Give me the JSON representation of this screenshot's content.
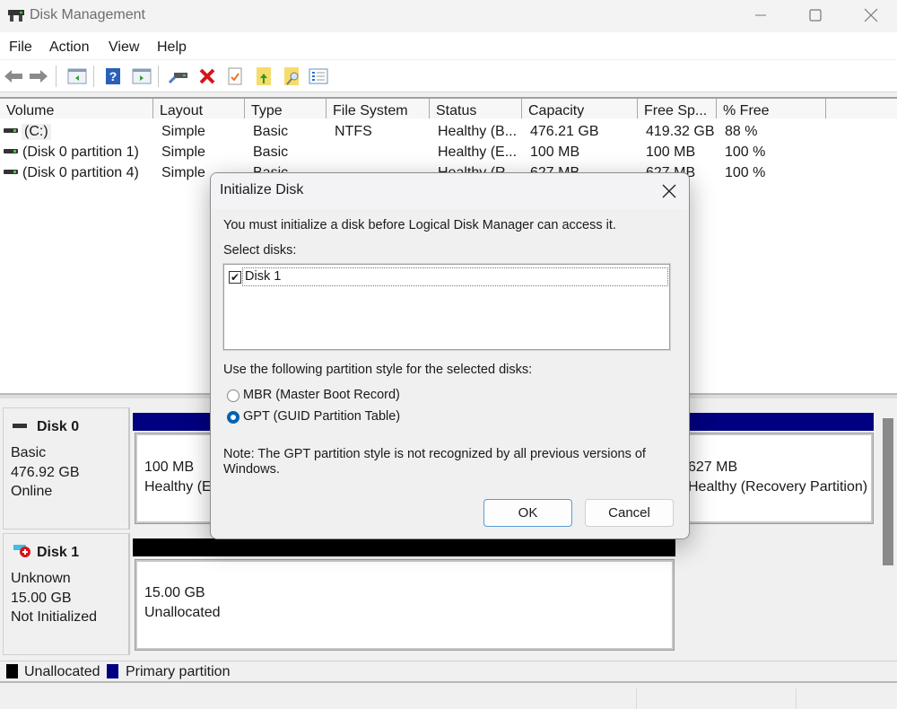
{
  "window": {
    "title": "Disk Management",
    "controls": {
      "minimize": "minimize",
      "maximize": "maximize",
      "close": "close"
    }
  },
  "menu": [
    "File",
    "Action",
    "View",
    "Help"
  ],
  "toolbar": [
    {
      "icon": "back-arrow-icon"
    },
    {
      "icon": "forward-arrow-icon"
    },
    {
      "icon": "show-hide-console-tree-icon"
    },
    {
      "icon": "help-icon"
    },
    {
      "icon": "show-hide-action-pane-icon"
    },
    {
      "icon": "connect-drive-icon"
    },
    {
      "icon": "delete-icon"
    },
    {
      "icon": "properties-check-icon"
    },
    {
      "icon": "export-folder-icon"
    },
    {
      "icon": "search-folder-icon"
    },
    {
      "icon": "checklist-icon"
    }
  ],
  "volume_list": {
    "columns": [
      "Volume",
      "Layout",
      "Type",
      "File System",
      "Status",
      "Capacity",
      "Free Sp...",
      "% Free"
    ],
    "rows": [
      {
        "volume": "(C:)",
        "layout": "Simple",
        "type": "Basic",
        "fs": "NTFS",
        "status": "Healthy (B...",
        "capacity": "476.21 GB",
        "free": "419.32 GB",
        "pct": "88 %"
      },
      {
        "volume": "(Disk 0 partition 1)",
        "layout": "Simple",
        "type": "Basic",
        "fs": "",
        "status": "Healthy (E...",
        "capacity": "100 MB",
        "free": "100 MB",
        "pct": "100 %"
      },
      {
        "volume": "(Disk 0 partition 4)",
        "layout": "Simple",
        "type": "Basic",
        "fs": "",
        "status": "Healthy (R...",
        "capacity": "627 MB",
        "free": "627 MB",
        "pct": "100 %"
      }
    ]
  },
  "disks": [
    {
      "name": "Disk 0",
      "type": "Basic",
      "size": "476.92 GB",
      "state": "Online",
      "partitions": [
        {
          "size": "100 MB",
          "status": "Healthy (EFI System Partition)",
          "kind": "primary"
        },
        {
          "size": "627 MB",
          "status": "Healthy (Recovery Partition)",
          "kind": "primary"
        }
      ]
    },
    {
      "name": "Disk 1",
      "type": "Unknown",
      "size": "15.00 GB",
      "state": "Not Initialized",
      "partitions": [
        {
          "size": "15.00 GB",
          "status": "Unallocated",
          "kind": "unallocated"
        }
      ]
    }
  ],
  "legend": [
    {
      "label": "Unallocated",
      "color": "#000000"
    },
    {
      "label": "Primary partition",
      "color": "#000080"
    }
  ],
  "dialog": {
    "title": "Initialize Disk",
    "message": "You must initialize a disk before Logical Disk Manager can access it.",
    "select_label": "Select disks:",
    "disk_items": [
      {
        "label": "Disk 1",
        "checked": true
      }
    ],
    "style_label": "Use the following partition style for the selected disks:",
    "options": [
      {
        "label": "MBR (Master Boot Record)",
        "selected": false
      },
      {
        "label": "GPT (GUID Partition Table)",
        "selected": true
      }
    ],
    "note_line1": "Note: The GPT partition style is not recognized by all previous versions of",
    "note_line2": "Windows.",
    "ok_label": "OK",
    "cancel_label": "Cancel"
  },
  "colors": {
    "primary_partition": "#000080",
    "unallocated": "#000000",
    "radio_accent": "#0063b1"
  }
}
